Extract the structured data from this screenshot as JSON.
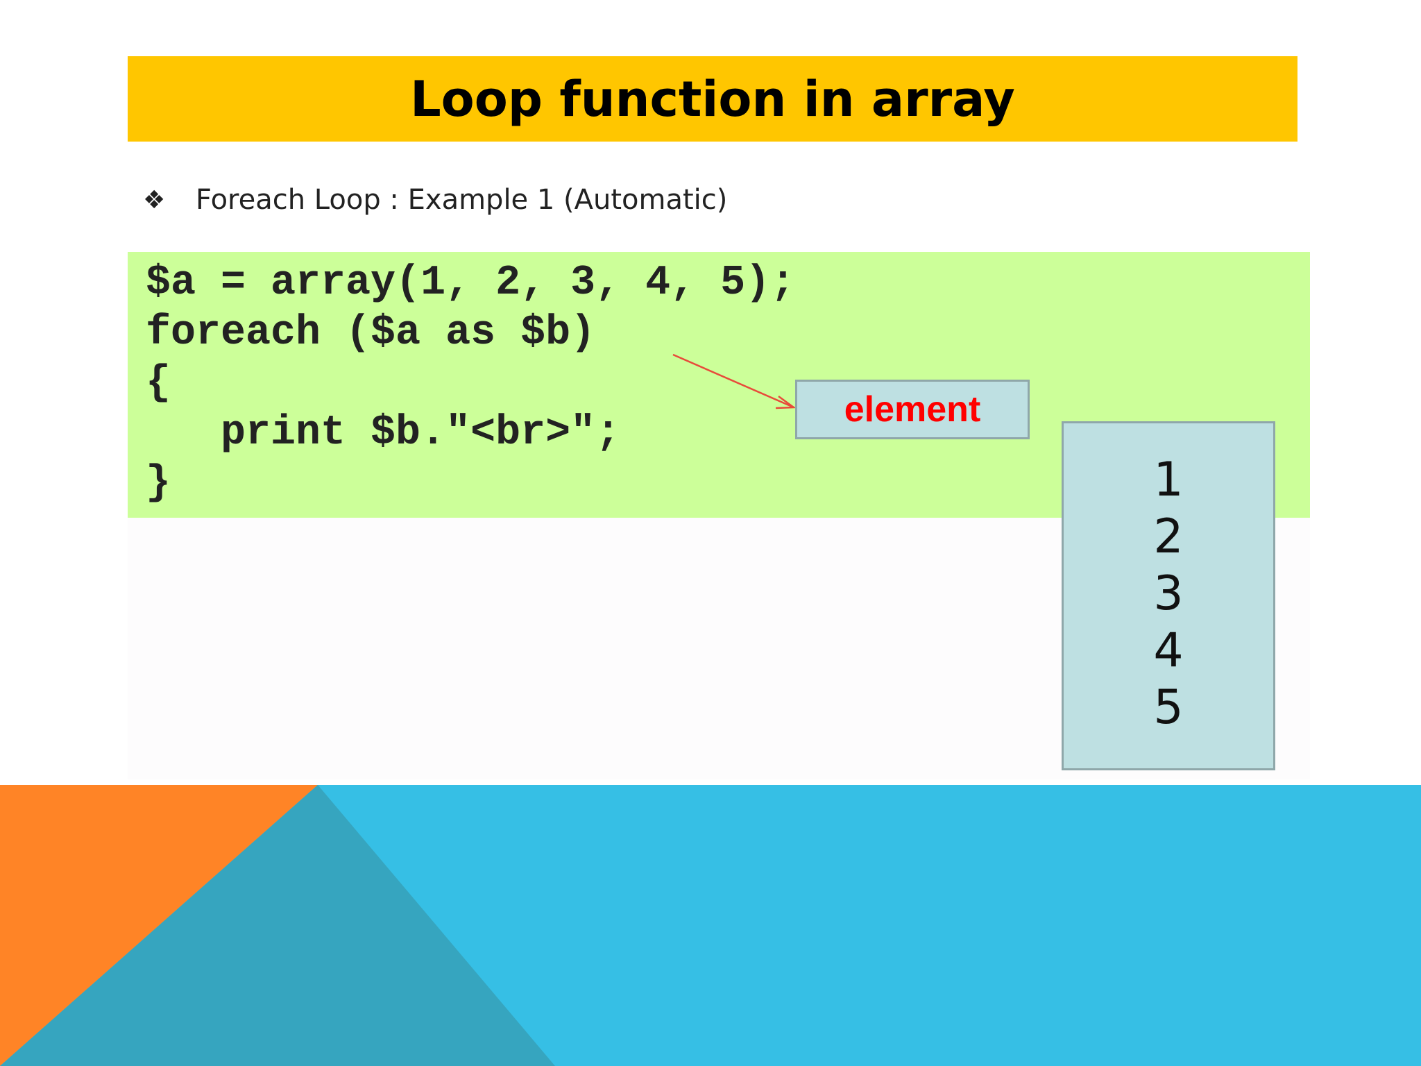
{
  "slide": {
    "title": "Loop function in array",
    "bullet": {
      "icon": "diamond-bullet-icon",
      "glyph": "❖",
      "text": "Foreach Loop : Example 1 (Automatic)"
    },
    "code": {
      "lines": [
        "$a = array(1, 2, 3, 4, 5);",
        "foreach ($a as $b)",
        "{",
        "   print $b.\"<br>\";",
        "}"
      ]
    },
    "callout": {
      "label": "element"
    },
    "output": {
      "values": [
        "1",
        "2",
        "3",
        "4",
        "5"
      ]
    },
    "colors": {
      "title_bar": "#FFC600",
      "code_background": "#CCFF99",
      "callout_text": "#FF0000",
      "box_fill": "#BEE0E2",
      "footer_blue": "#36BFE5",
      "footer_orange": "#FF8426",
      "footer_teal": "#36A5BF"
    }
  }
}
